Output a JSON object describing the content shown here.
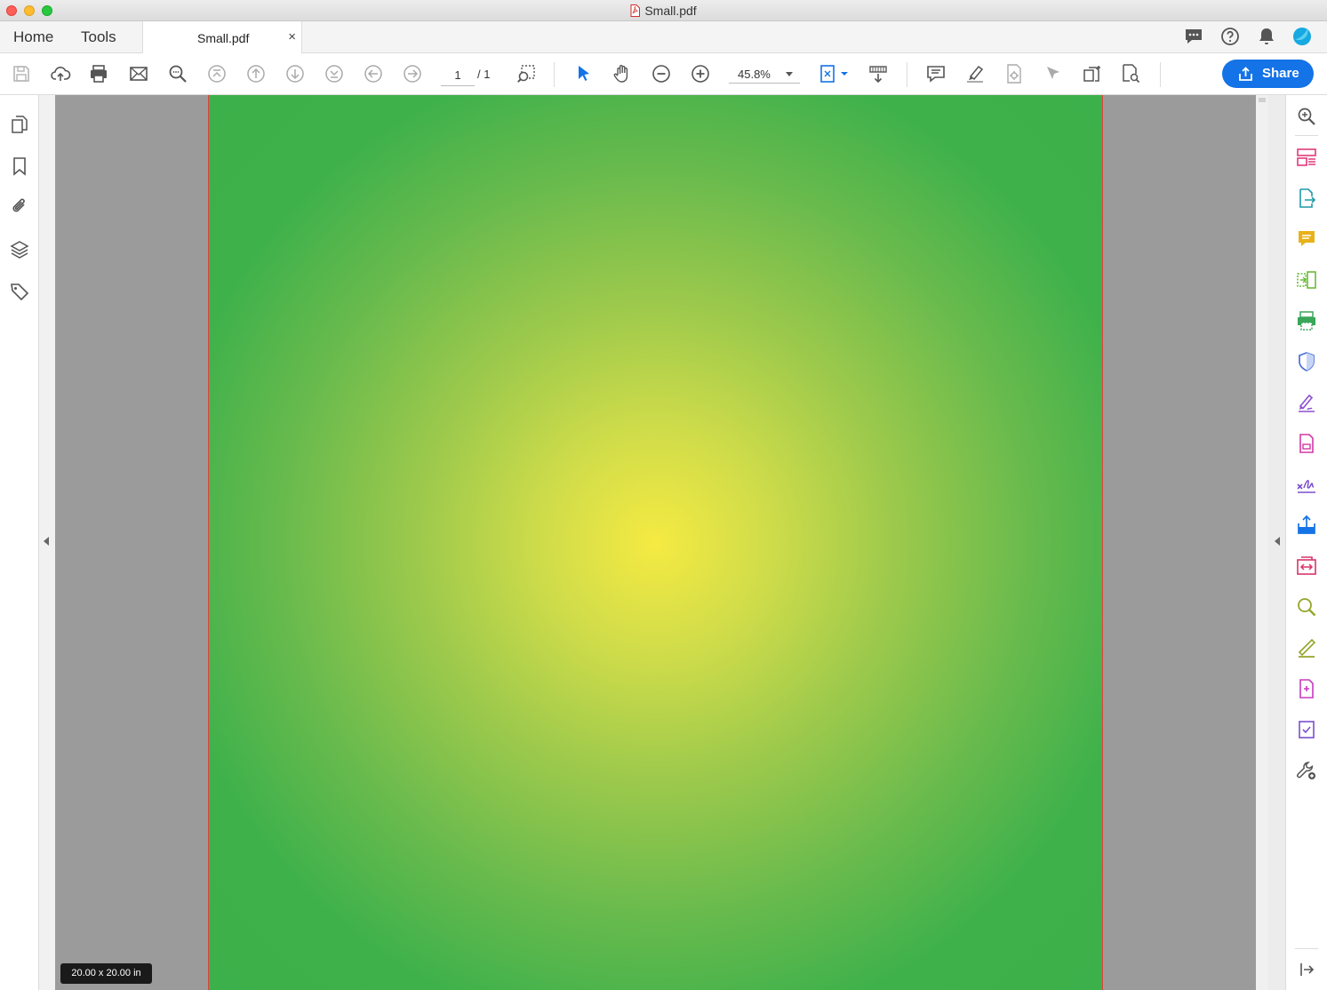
{
  "window": {
    "title": "Small.pdf"
  },
  "tabs": {
    "home": "Home",
    "tools": "Tools",
    "document": "Small.pdf",
    "close_glyph": "×"
  },
  "toolbar": {
    "page_current": "1",
    "page_total": "/ 1",
    "zoom": "45.8%",
    "share_label": "Share"
  },
  "document": {
    "page_size": "20.00 x 20.00 in",
    "gradient": {
      "center": "#f5ea42",
      "edge": "#3cb04a"
    }
  },
  "colors": {
    "accent": "#1473e6",
    "page_border": "#e04040"
  }
}
